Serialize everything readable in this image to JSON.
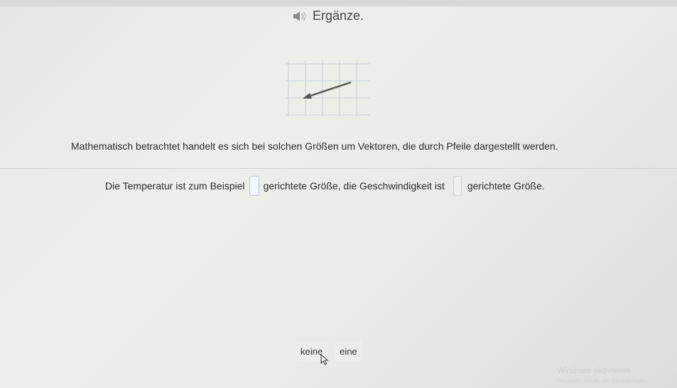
{
  "header": {
    "title": "Ergänze.",
    "audio_icon": "speaker-icon"
  },
  "figure": {
    "type": "grid-with-arrow",
    "arrow_color": "#555555",
    "grid_color": "#c8d0da"
  },
  "sentence_1": "Mathematisch betrachtet handelt es sich bei solchen Größen um Vektoren, die durch Pfeile dargestellt werden.",
  "sentence_2": {
    "part_1": "Die Temperatur ist zum Beispiel",
    "part_2": "gerichtete Größe, die Geschwindigkeit ist",
    "part_3": "gerichtete Größe.",
    "blank_1_value": "",
    "blank_2_value": ""
  },
  "choices": [
    {
      "label": "keine"
    },
    {
      "label": "eine"
    }
  ],
  "watermark": {
    "line_1": "Windows aktivieren",
    "line_2": "Wechseln Sie zu den Einstellungen"
  }
}
